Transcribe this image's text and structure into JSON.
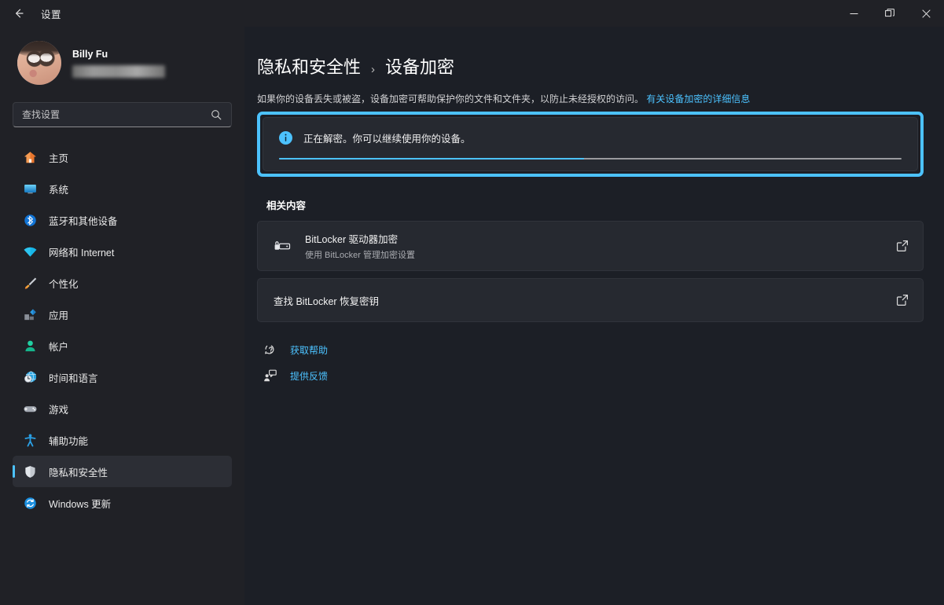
{
  "window": {
    "title": "设置",
    "back_icon": "arrow-left-icon",
    "controls": {
      "minimize_label": "最小化",
      "maximize_label": "还原",
      "close_label": "关闭"
    }
  },
  "account": {
    "name": "Billy Fu",
    "email_redacted": "",
    "avatar_alt": "用户头像"
  },
  "search": {
    "placeholder": "查找设置",
    "value": "",
    "icon": "search-icon"
  },
  "sidebar": {
    "items": [
      {
        "label": "主页",
        "icon": "home-icon",
        "active": false
      },
      {
        "label": "系统",
        "icon": "system-icon",
        "active": false
      },
      {
        "label": "蓝牙和其他设备",
        "icon": "bluetooth-icon",
        "active": false
      },
      {
        "label": "网络和 Internet",
        "icon": "wifi-icon",
        "active": false
      },
      {
        "label": "个性化",
        "icon": "brush-icon",
        "active": false
      },
      {
        "label": "应用",
        "icon": "apps-icon",
        "active": false
      },
      {
        "label": "帐户",
        "icon": "account-icon",
        "active": false
      },
      {
        "label": "时间和语言",
        "icon": "clock-globe-icon",
        "active": false
      },
      {
        "label": "游戏",
        "icon": "gamepad-icon",
        "active": false
      },
      {
        "label": "辅助功能",
        "icon": "accessibility-icon",
        "active": false
      },
      {
        "label": "隐私和安全性",
        "icon": "shield-icon",
        "active": true
      },
      {
        "label": "Windows 更新",
        "icon": "update-icon",
        "active": false
      }
    ]
  },
  "main": {
    "breadcrumb": {
      "parent": "隐私和安全性",
      "separator": "›",
      "current": "设备加密"
    },
    "intro": {
      "text": "如果你的设备丢失或被盗，设备加密可帮助保护你的文件和文件夹，以防止未经授权的访问。",
      "link": "有关设备加密的详细信息"
    },
    "status_banner": {
      "icon": "info-icon",
      "message": "正在解密。你可以继续使用你的设备。",
      "progress_percent": 49
    },
    "section_title": "相关内容",
    "cards": [
      {
        "icon": "drive-lock-icon",
        "title": "BitLocker 驱动器加密",
        "subtitle": "使用 BitLocker 管理加密设置",
        "end_icon": "external-link-icon"
      },
      {
        "icon": "",
        "title": "查找 BitLocker 恢复密钥",
        "subtitle": "",
        "end_icon": "external-link-icon"
      }
    ],
    "links": [
      {
        "label": "获取帮助",
        "icon": "help-icon"
      },
      {
        "label": "提供反馈",
        "icon": "feedback-icon"
      }
    ]
  },
  "colors": {
    "accent": "#4cc2ff",
    "window_bg": "#1c1f26",
    "sidebar_bg": "#202126",
    "card_bg": "#262930",
    "text_primary": "#f0f0f0",
    "text_secondary": "#a9abb0"
  }
}
